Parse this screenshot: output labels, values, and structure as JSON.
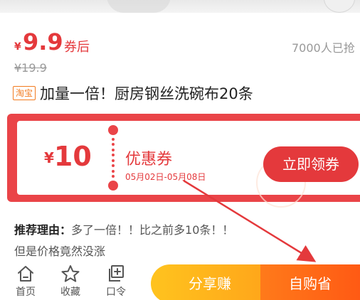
{
  "product": {
    "currency_symbol": "¥",
    "price": "9.9",
    "price_tag": "券后",
    "sold_count": "7000人已抢",
    "original_price": "¥19.9",
    "platform_badge": "淘宝",
    "title": "加量一倍！厨房钢丝洗碗布20条"
  },
  "coupon": {
    "currency_symbol": "¥",
    "amount": "10",
    "name": "优惠券",
    "validity": "05月02日-05月08日",
    "claim_label": "立即领券"
  },
  "reason": {
    "label": "推荐理由：",
    "line1": "多了一倍！！比之前多10条！！",
    "line2": "但是价格竟然没涨"
  },
  "bottom_bar": {
    "home_label": "首页",
    "favorite_label": "收藏",
    "command_label": "口令",
    "share_label": "分享赚",
    "buy_label": "自购省"
  },
  "colors": {
    "accent_red": "#e4393c",
    "share_yellow": "#ffb31c",
    "buy_orange": "#ff6a16",
    "taobao_orange": "#f27a1e"
  },
  "icons": [
    "home-icon",
    "star-icon",
    "plus-square-icon"
  ]
}
